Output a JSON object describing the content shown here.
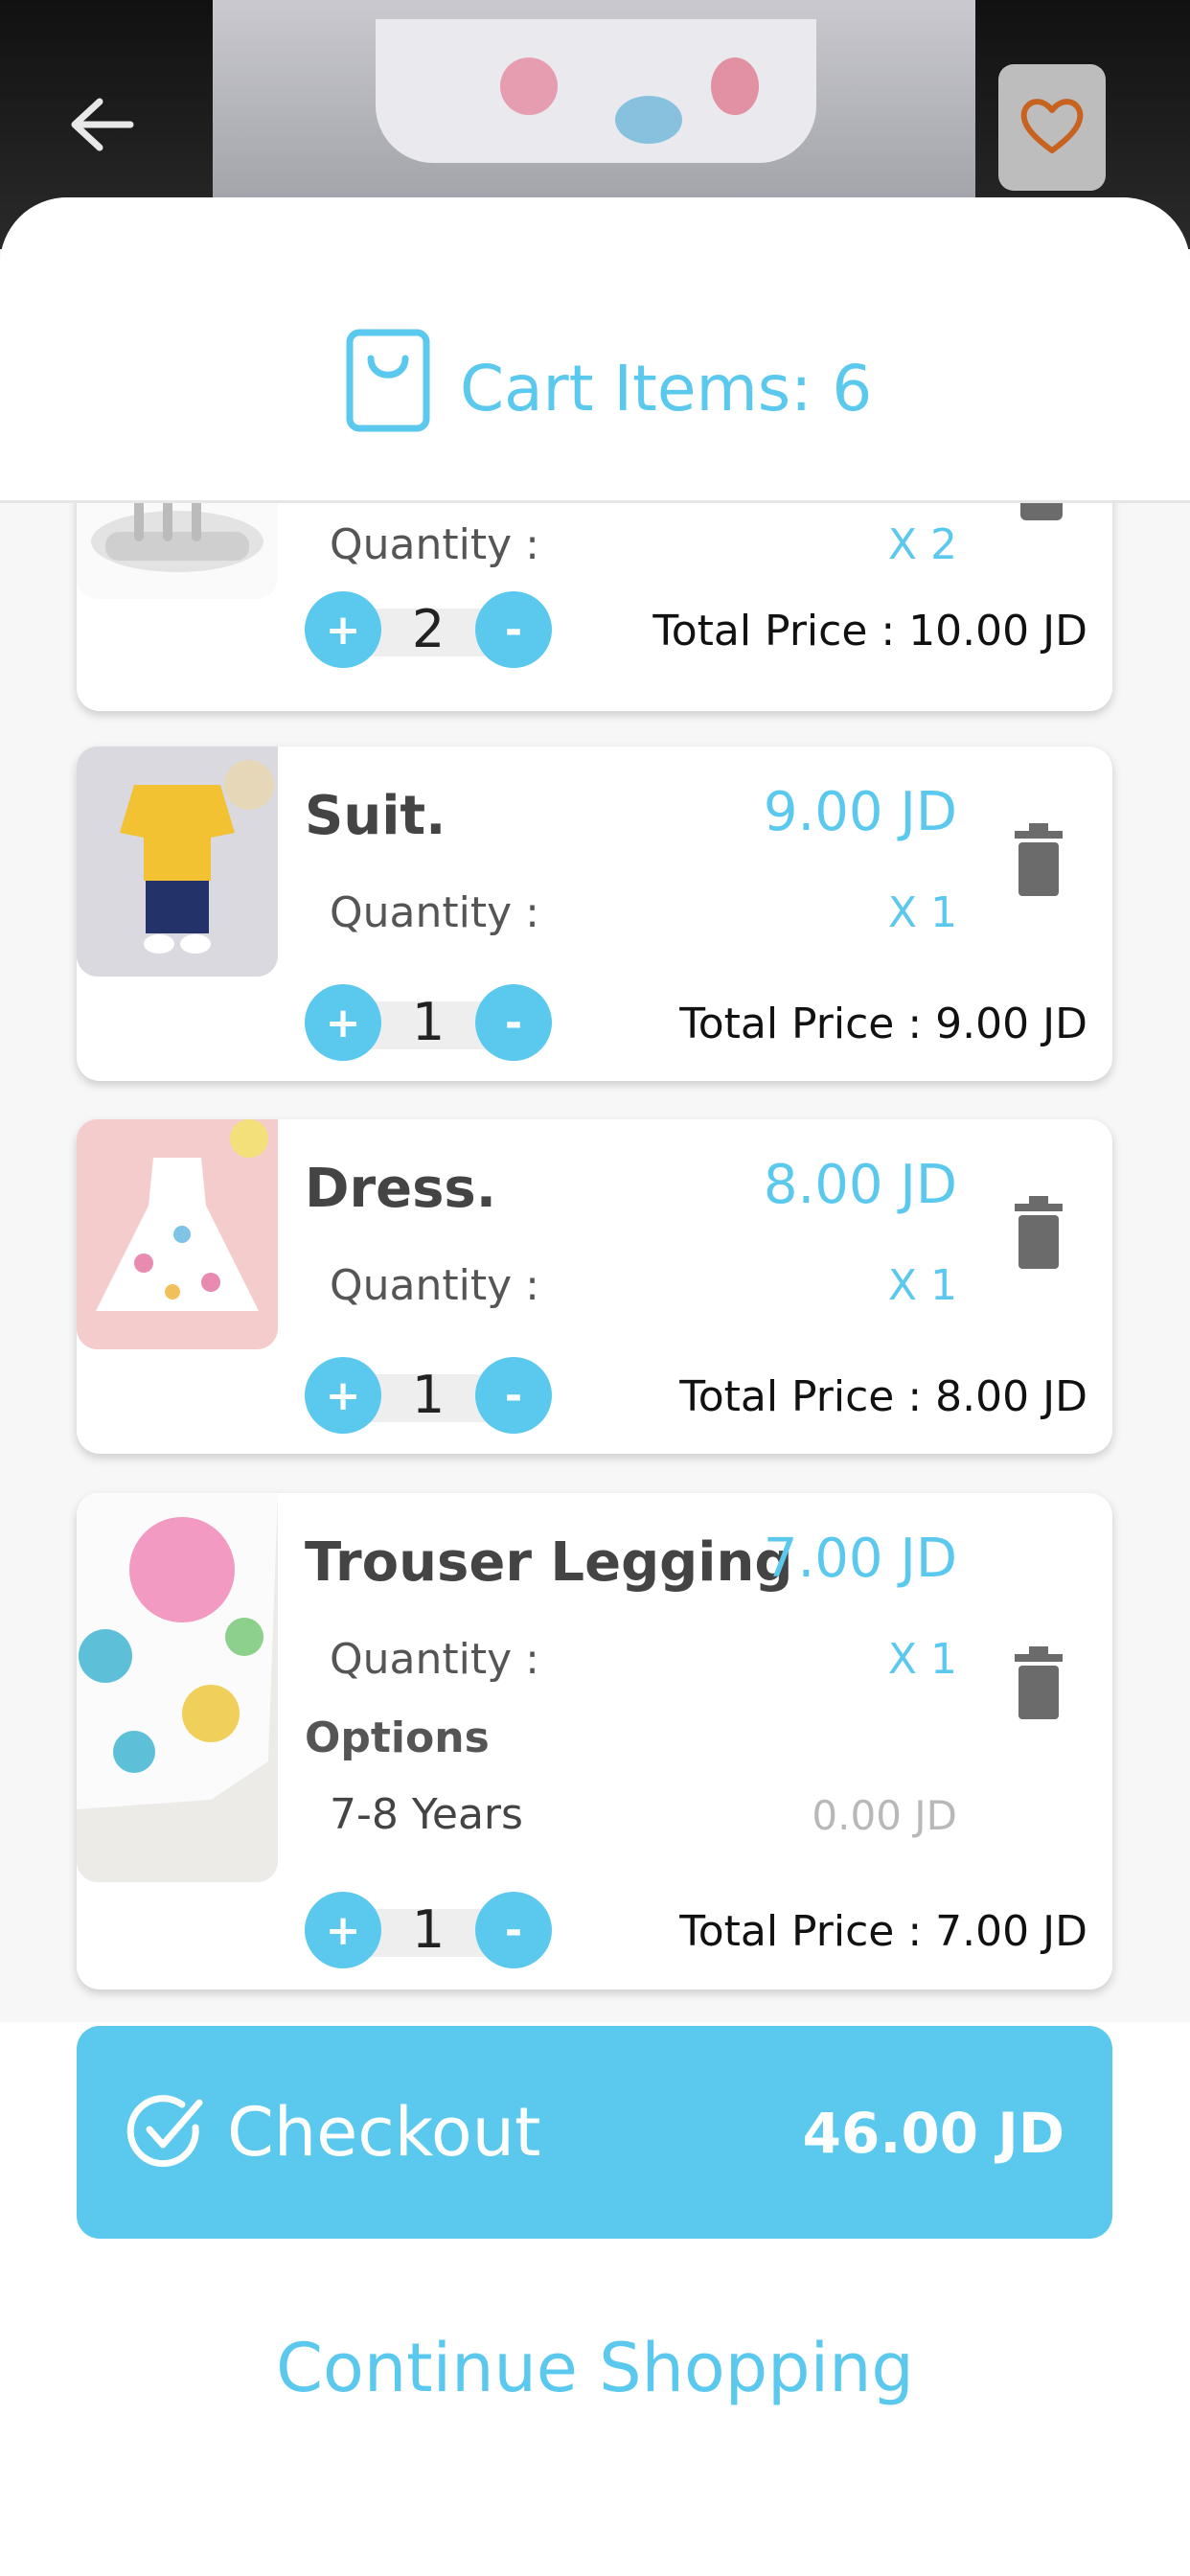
{
  "header": {
    "cart_title": "Cart Items: 6"
  },
  "items": [
    {
      "name": "",
      "price": "",
      "quantity_label": "Quantity :",
      "quantity_x": "X 2",
      "qty": "2",
      "plus": "+",
      "minus": "-",
      "total": "Total Price : 10.00 JD"
    },
    {
      "name": "Suit.",
      "price": "9.00 JD",
      "quantity_label": "Quantity :",
      "quantity_x": "X 1",
      "qty": "1",
      "plus": "+",
      "minus": "-",
      "total": "Total Price : 9.00 JD"
    },
    {
      "name": "Dress.",
      "price": "8.00 JD",
      "quantity_label": "Quantity :",
      "quantity_x": "X 1",
      "qty": "1",
      "plus": "+",
      "minus": "-",
      "total": "Total Price : 8.00 JD"
    },
    {
      "name": "Trouser Legging",
      "price": "7.00 JD",
      "quantity_label": "Quantity :",
      "quantity_x": "X 1",
      "options_title": "Options",
      "option_value": "7-8 Years",
      "option_price": "0.00 JD",
      "qty": "1",
      "plus": "+",
      "minus": "-",
      "total": "Total Price : 7.00 JD"
    }
  ],
  "checkout": {
    "label": "Checkout",
    "amount": "46.00 JD"
  },
  "continue_label": "Continue Shopping",
  "icons": {
    "back": "back-arrow-icon",
    "favorite": "heart-icon",
    "bag": "shopping-bag-icon",
    "trash": "trash-icon",
    "check": "check-circle-icon"
  },
  "colors": {
    "accent": "#5bc8ee",
    "favorite": "#c8621f"
  }
}
